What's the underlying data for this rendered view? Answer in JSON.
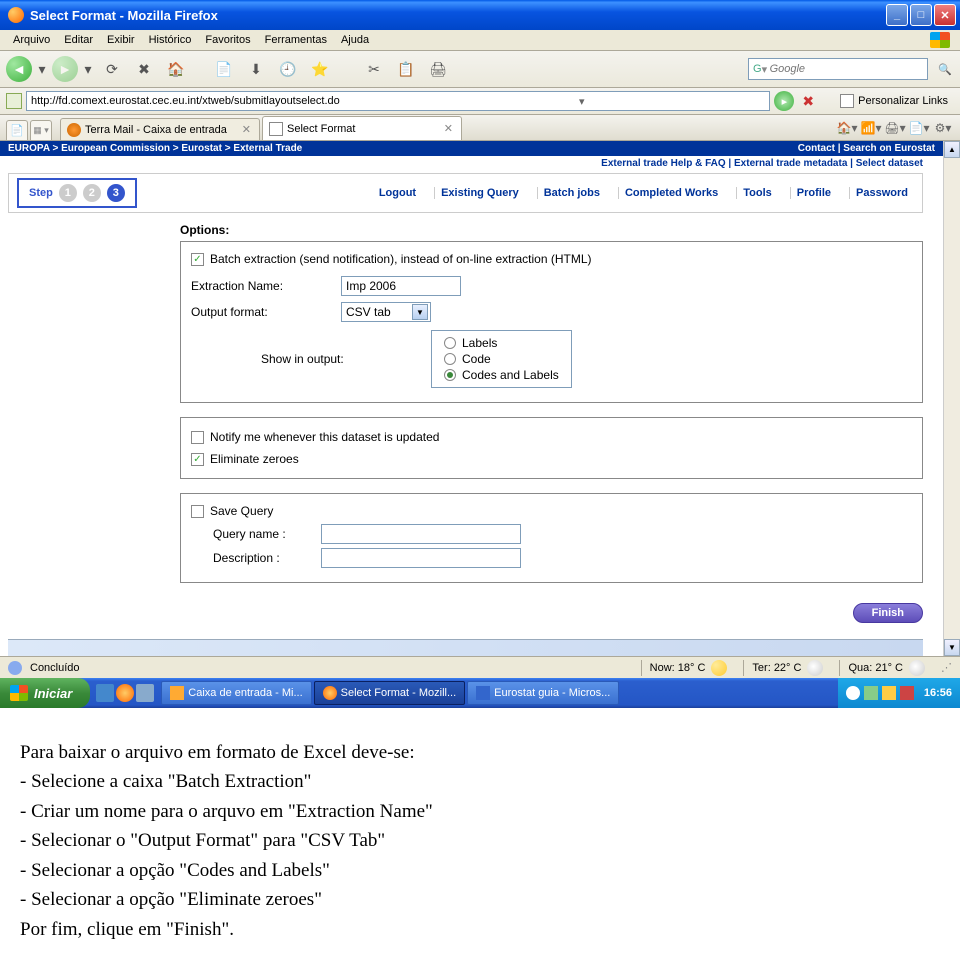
{
  "window": {
    "title": "Select Format - Mozilla Firefox"
  },
  "menubar": [
    "Arquivo",
    "Editar",
    "Exibir",
    "Histórico",
    "Favoritos",
    "Ferramentas",
    "Ajuda"
  ],
  "searchbox": {
    "placeholder": "Google"
  },
  "address": {
    "url": "http://fd.comext.eurostat.cec.eu.int/xtweb/submitlayoutselect.do",
    "personalize": "Personalizar Links"
  },
  "tabs": [
    {
      "title": "Terra Mail - Caixa de entrada",
      "active": false
    },
    {
      "title": "Select Format",
      "active": true
    }
  ],
  "breadcrumb": {
    "left": "EUROPA > European Commission > Eurostat > External Trade",
    "right": "Contact | Search on Eurostat"
  },
  "subheader": "External trade Help & FAQ  |  External trade metadata  |  Select dataset",
  "step": {
    "label": "Step",
    "nums": [
      "1",
      "2",
      "3"
    ]
  },
  "navlinks": [
    "Logout",
    "Existing Query",
    "Batch jobs",
    "Completed Works",
    "Tools",
    "Profile",
    "Password"
  ],
  "form": {
    "options_label": "Options:",
    "batch_checkbox": "Batch extraction (send notification), instead of on-line extraction (HTML)",
    "extraction_name_label": "Extraction Name:",
    "extraction_name_value": "Imp 2006",
    "output_format_label": "Output format:",
    "output_format_value": "CSV tab",
    "show_in_output_label": "Show in output:",
    "radios": [
      "Labels",
      "Code",
      "Codes and Labels"
    ],
    "notify_label": "Notify me whenever this dataset is updated",
    "eliminate_label": "Eliminate zeroes",
    "save_query_label": "Save Query",
    "query_name_label": "Query name :",
    "description_label": "Description :",
    "finish_label": "Finish"
  },
  "statusbar": {
    "status": "Concluído",
    "weather": [
      {
        "label": "Now: 18° C"
      },
      {
        "label": "Ter: 22° C"
      },
      {
        "label": "Qua: 21° C"
      }
    ]
  },
  "taskbar": {
    "start": "Iniciar",
    "tasks": [
      "Caixa de entrada - Mi...",
      "Select Format - Mozill...",
      "Eurostat guia - Micros..."
    ],
    "clock": "16:56"
  },
  "doc": {
    "l1": "Para baixar o arquivo em formato de Excel deve-se:",
    "l2": "- Selecione a caixa \"Batch Extraction\"",
    "l3": "- Criar um nome para o arquvo em \"Extraction Name\"",
    "l4": "- Selecionar o \"Output Format\" para \"CSV Tab\"",
    "l5": "- Selecionar a opção \"Codes and Labels\"",
    "l6": "- Selecionar a opção \"Eliminate zeroes\"",
    "l7": "Por fim, clique em \"Finish\"."
  }
}
